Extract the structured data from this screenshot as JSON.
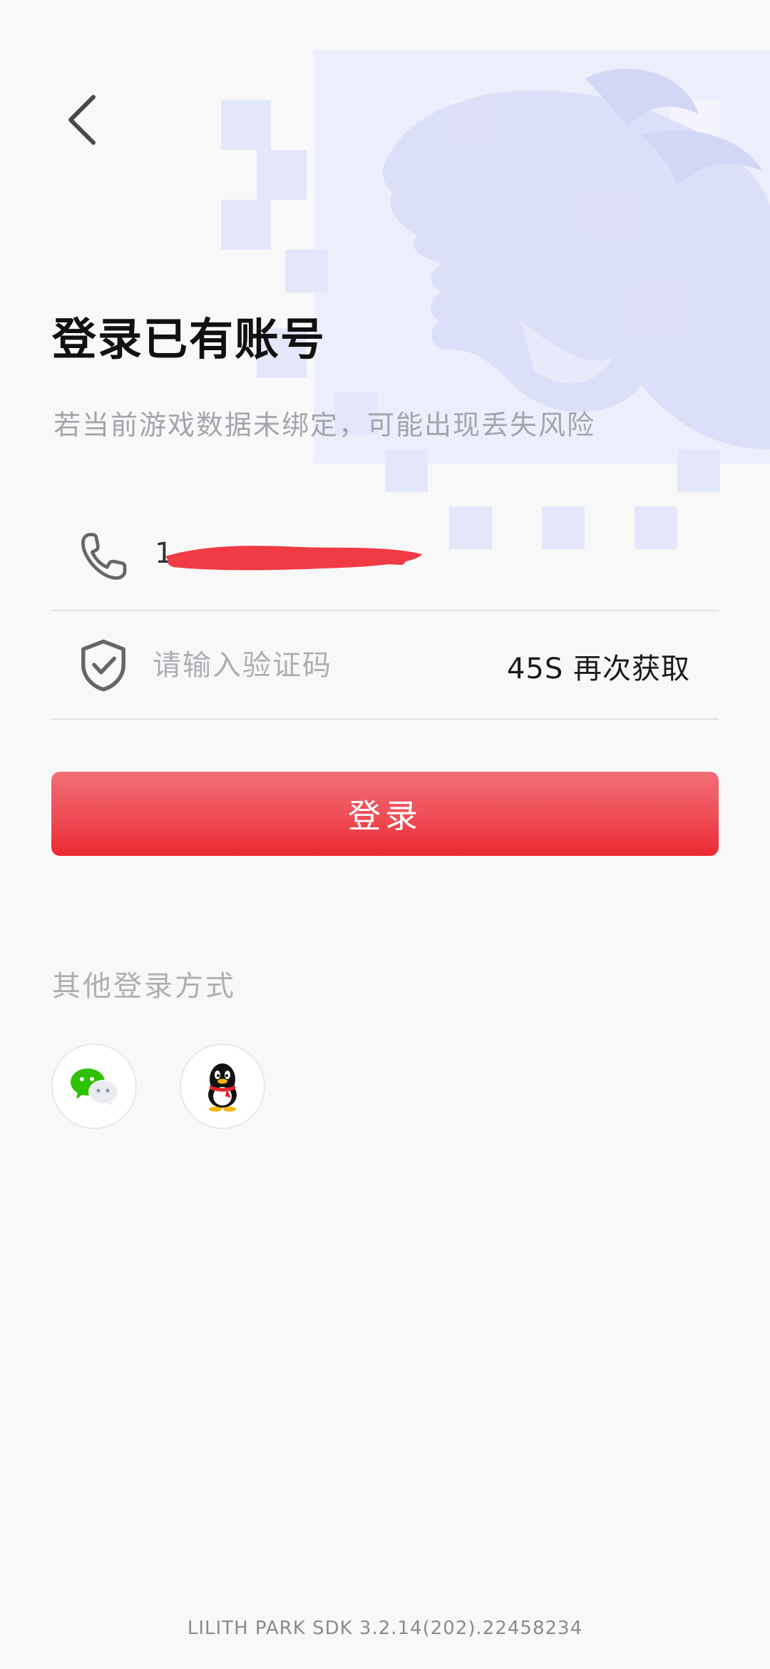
{
  "header": {
    "back_icon": "chevron-left-icon"
  },
  "title": "登录已有账号",
  "subtitle": "若当前游戏数据未绑定，可能出现丢失风险",
  "phone_field": {
    "icon": "phone-icon",
    "value": "1"
  },
  "code_field": {
    "icon": "shield-check-icon",
    "placeholder": "请输入验证码",
    "value": "",
    "resend_label": "45S 再次获取"
  },
  "login_button": {
    "label": "登录",
    "color": "#ee3a42"
  },
  "other_login": {
    "label": "其他登录方式",
    "options": [
      {
        "name": "WeChat",
        "icon": "wechat-icon"
      },
      {
        "name": "QQ",
        "icon": "qq-penguin-icon"
      }
    ]
  },
  "footer": {
    "version": "LILITH PARK SDK 3.2.14(202).22458234"
  }
}
